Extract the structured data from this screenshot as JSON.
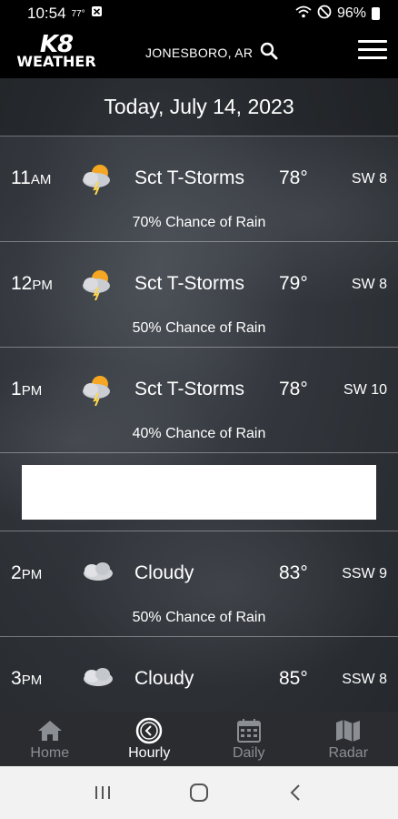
{
  "status_bar": {
    "time": "10:54",
    "temp": "77°",
    "battery": "96%"
  },
  "header": {
    "logo_top": "K8",
    "logo_bottom": "WEATHER",
    "location": "JONESBORO, AR"
  },
  "date_title": "Today, July 14, 2023",
  "hours": [
    {
      "hour": "11",
      "ampm": "AM",
      "icon": "storm-icon",
      "condition": "Sct T-Storms",
      "temp": "78°",
      "wind": "SW 8",
      "rain": "70% Chance of Rain"
    },
    {
      "hour": "12",
      "ampm": "PM",
      "icon": "storm-icon",
      "condition": "Sct T-Storms",
      "temp": "79°",
      "wind": "SW 8",
      "rain": "50% Chance of Rain"
    },
    {
      "hour": "1",
      "ampm": "PM",
      "icon": "storm-icon",
      "condition": "Sct T-Storms",
      "temp": "78°",
      "wind": "SW 10",
      "rain": "40% Chance of Rain"
    },
    {
      "hour": "2",
      "ampm": "PM",
      "icon": "cloud-icon",
      "condition": "Cloudy",
      "temp": "83°",
      "wind": "SSW 9",
      "rain": "50% Chance of Rain"
    },
    {
      "hour": "3",
      "ampm": "PM",
      "icon": "cloud-icon",
      "condition": "Cloudy",
      "temp": "85°",
      "wind": "SSW 8",
      "rain": ""
    }
  ],
  "tabs": [
    {
      "label": "Home",
      "icon": "home-icon"
    },
    {
      "label": "Hourly",
      "icon": "clock-icon",
      "active": true
    },
    {
      "label": "Daily",
      "icon": "calendar-icon"
    },
    {
      "label": "Radar",
      "icon": "map-icon"
    }
  ]
}
